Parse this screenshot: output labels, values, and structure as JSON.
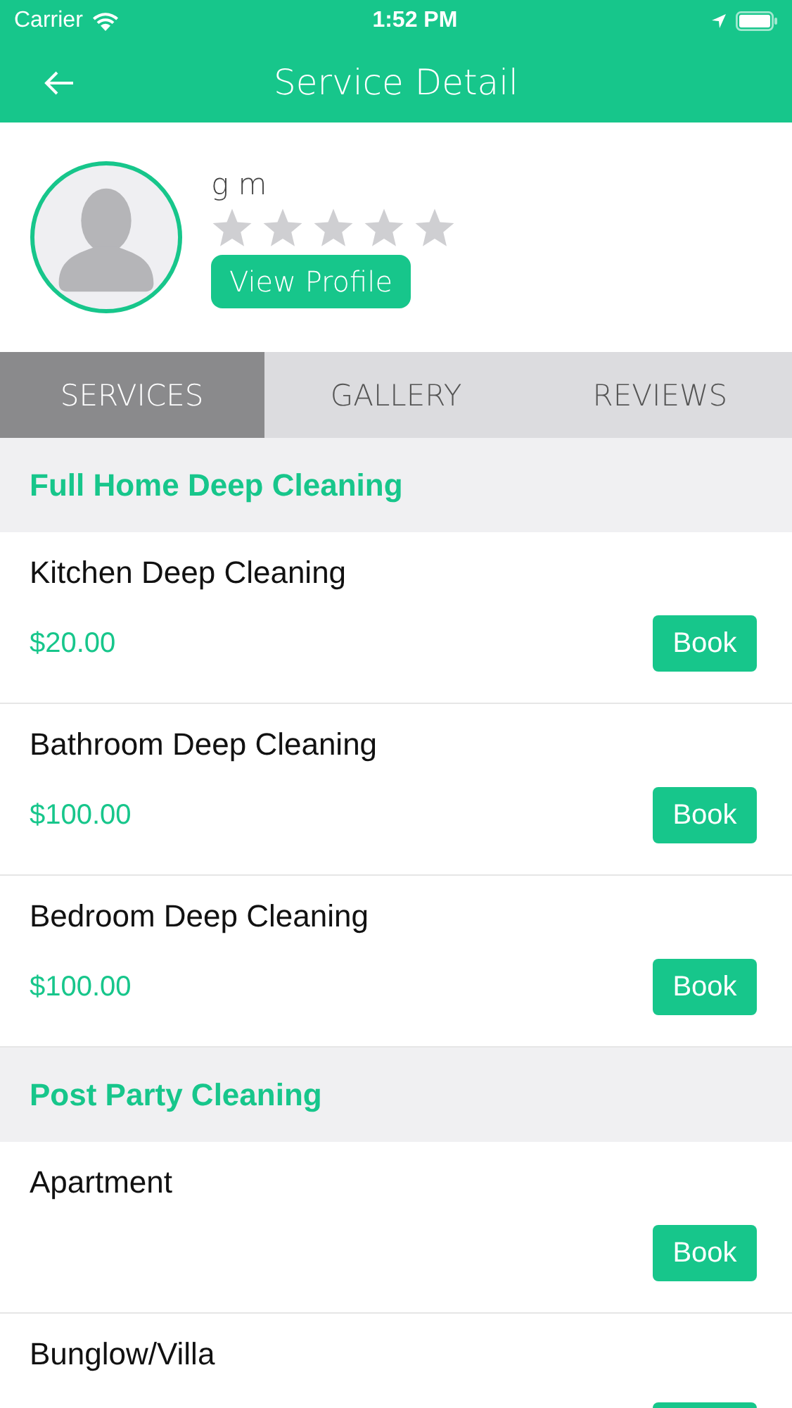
{
  "status_bar": {
    "carrier": "Carrier",
    "time": "1:52 PM"
  },
  "header": {
    "title": "Service Detail"
  },
  "profile": {
    "name": "g m",
    "stars": 0,
    "button": "View Profile"
  },
  "tabs": [
    {
      "label": "SERVICES",
      "selected": true
    },
    {
      "label": "GALLERY",
      "selected": false
    },
    {
      "label": "REVIEWS",
      "selected": false
    }
  ],
  "categories": [
    {
      "title": "Full Home Deep Cleaning",
      "items": [
        {
          "name": "Kitchen Deep Cleaning",
          "price": "$20.00",
          "button": "Book"
        },
        {
          "name": "Bathroom Deep Cleaning",
          "price": "$100.00",
          "button": "Book"
        },
        {
          "name": "Bedroom Deep Cleaning",
          "price": "$100.00",
          "button": "Book"
        }
      ]
    },
    {
      "title": "Post Party Cleaning",
      "items": [
        {
          "name": "Apartment",
          "button": "Book"
        },
        {
          "name": "Bunglow/Villa",
          "button_cut": true
        }
      ]
    }
  ]
}
